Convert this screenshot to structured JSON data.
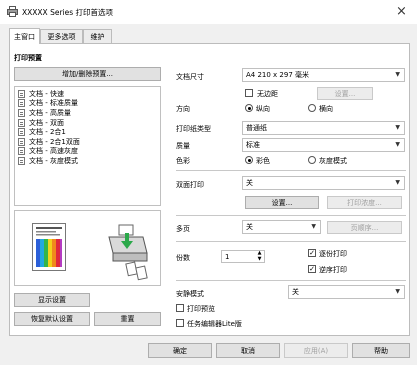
{
  "window": {
    "title": "XXXXX Series 打印首选项",
    "close_glyph": "×"
  },
  "tabs": [
    {
      "label": "主窗口"
    },
    {
      "label": "更多选项"
    },
    {
      "label": "维护"
    }
  ],
  "left": {
    "presets_heading": "打印预置",
    "add_remove_label": "增加/删除预置...",
    "preset_items": [
      "文档 - 快速",
      "文档 - 标准质量",
      "文档 - 高质量",
      "文档 - 双面",
      "文档 - 2合1",
      "文档 - 2合1双面",
      "文档 - 高速灰度",
      "文档 - 灰度模式"
    ],
    "show_settings_label": "显示设置",
    "restore_defaults_label": "恢复默认设置",
    "reset_label": "重置"
  },
  "settings": {
    "doc_size_label": "文档尺寸",
    "doc_size_value": "A4 210 x 297 毫米",
    "borderless_label": "无边距",
    "borderless_settings_label": "设置...",
    "orientation_label": "方向",
    "portrait_label": "纵向",
    "landscape_label": "横向",
    "paper_type_label": "打印纸类型",
    "paper_type_value": "普通纸",
    "quality_label": "质量",
    "quality_value": "标准",
    "color_label": "色彩",
    "color_option": "彩色",
    "grayscale_option": "灰度模式",
    "duplex_label": "双面打印",
    "duplex_value": "关",
    "duplex_settings_label": "设置...",
    "print_density_label": "打印浓度...",
    "multipage_label": "多页",
    "multipage_value": "关",
    "page_order_label": "页顺序...",
    "copies_label": "份数",
    "copies_value": "1",
    "collate_label": "逐份打印",
    "reverse_label": "逆序打印",
    "quiet_mode_label": "安静模式",
    "quiet_mode_value": "关",
    "preview_label": "打印预览",
    "job_arranger_label": "任务编辑器Lite版"
  },
  "footer": {
    "ok_label": "确定",
    "cancel_label": "取消",
    "apply_label": "应用(A)",
    "help_label": "帮助"
  },
  "colors": {
    "accent": "#1e6fd9",
    "window_bg": "#f0f0f0",
    "panel_bg": "#ffffff"
  },
  "icons": [
    "printer-app-icon",
    "close-icon",
    "document-preview-icon",
    "printer-icon",
    "chevron-down-icon"
  ]
}
